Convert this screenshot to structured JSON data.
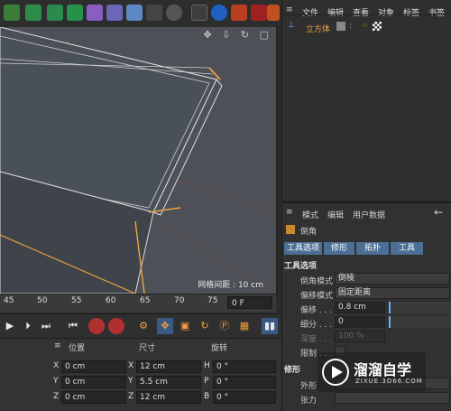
{
  "viewport": {
    "grid_label": "网格间距 : 10 cm",
    "nav_icons": "✥ ⇩ ↻ ▢"
  },
  "timeline": {
    "ticks": [
      "45",
      "50",
      "55",
      "60",
      "65",
      "70",
      "75"
    ],
    "frame_value": "0 F"
  },
  "coords": {
    "headers": {
      "position": "位置",
      "size": "尺寸",
      "rotation": "旋转"
    },
    "rows": [
      {
        "axis": "X",
        "position": "0 cm",
        "size_axis": "X",
        "size": "12 cm",
        "rot_axis": "H",
        "rotation": "0 °"
      },
      {
        "axis": "Y",
        "position": "0 cm",
        "size_axis": "Y",
        "size": "5.5 cm",
        "rot_axis": "P",
        "rotation": "0 °"
      },
      {
        "axis": "Z",
        "position": "0 cm",
        "size_axis": "Z",
        "size": "12 cm",
        "rot_axis": "B",
        "rotation": "0 °"
      }
    ]
  },
  "object_manager": {
    "menu": [
      "文件",
      "编辑",
      "查看",
      "对象",
      "标签",
      "书签"
    ],
    "object_name": "立方体"
  },
  "attributes": {
    "menu": [
      "模式",
      "编辑",
      "用户数据"
    ],
    "object_title": "倒角",
    "tabs": [
      "工具选项",
      "修形",
      "拓扑",
      "工具"
    ],
    "section_tool_options": "工具选项",
    "props": [
      {
        "label": "倒角模式",
        "value": "倒棱"
      },
      {
        "label": "偏移模式",
        "value": "固定距离"
      },
      {
        "label": "偏移 . . .",
        "value": "0.8 cm"
      },
      {
        "label": "细分 . . .",
        "value": "0"
      },
      {
        "label": "深度 . . .",
        "value": "100 %"
      },
      {
        "label": "限制 . . .",
        "value": ""
      }
    ],
    "section_shape": "修形",
    "shape_props": [
      {
        "label": "外形",
        "value": ""
      },
      {
        "label": "张力",
        "value": ""
      }
    ]
  },
  "watermark": {
    "title": "溜溜自学",
    "subtitle": "ZIXUE.3D66.COM"
  },
  "colors": {
    "accent_blue": "#4b6f95",
    "selection_orange": "#f0a040",
    "viewport_bg": "#4d5157"
  }
}
